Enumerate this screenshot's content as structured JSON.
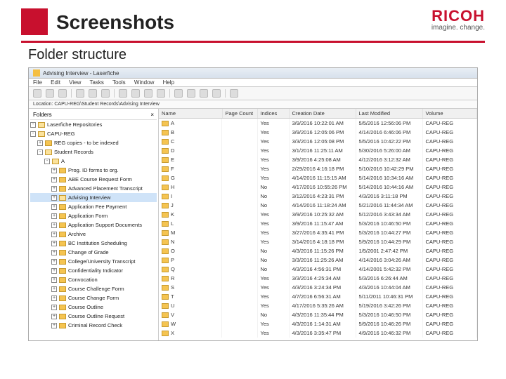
{
  "slide": {
    "title": "Screenshots",
    "subtitle": "Folder structure"
  },
  "logo": {
    "brand": "RICOH",
    "tagline": "imagine. change."
  },
  "window": {
    "title": "Advising Interview - Laserfiche"
  },
  "menu": {
    "file": "File",
    "edit": "Edit",
    "view": "View",
    "tasks": "Tasks",
    "tools": "Tools",
    "window": "Window",
    "help": "Help"
  },
  "breadcrumb": "Location:  CAPU-REG\\Student Records\\Advising Interview",
  "tree": {
    "header": "Folders",
    "close": "×",
    "root": "Laserfiche Repositories",
    "repo": "CAPU-REG",
    "items": [
      "REG copies - to be indexed",
      "Student Records",
      "A",
      "Prog. ID forms to org.",
      "ABE Course Request Form",
      "Advanced Placement Transcript",
      "Advising Interview",
      "Application Fee Payment",
      "Application Form",
      "Application Support Documents",
      "Archive",
      "BC Institution Scheduling",
      "Change of Grade",
      "College/University Transcript",
      "Confidentiality Indicator",
      "Convocation",
      "Course Challenge Form",
      "Course Change Form",
      "Course Outline",
      "Course Outline Request",
      "Criminal Record Check"
    ]
  },
  "columns": {
    "name": "Name",
    "pagecount": "Page Count",
    "indices": "Indices",
    "creation": "Creation Date",
    "modified": "Last Modified",
    "volume": "Volume"
  },
  "rows": [
    {
      "name": "A",
      "pc": "",
      "idx": "Yes",
      "cd": "3/9/2016 10:22:01 AM",
      "lm": "5/5/2016 12:56:06 PM",
      "vol": "CAPU-REG"
    },
    {
      "name": "B",
      "pc": "",
      "idx": "Yes",
      "cd": "3/9/2016 12:05:06 PM",
      "lm": "4/14/2016 6:46:06 PM",
      "vol": "CAPU-REG"
    },
    {
      "name": "C",
      "pc": "",
      "idx": "Yes",
      "cd": "3/3/2016 12:05:08 PM",
      "lm": "5/5/2016 10:42:22 PM",
      "vol": "CAPU-REG"
    },
    {
      "name": "D",
      "pc": "",
      "idx": "Yes",
      "cd": "3/1/2016 11:25:11 AM",
      "lm": "5/30/2016 5:26:00 AM",
      "vol": "CAPU-REG"
    },
    {
      "name": "E",
      "pc": "",
      "idx": "Yes",
      "cd": "3/9/2016 4:25:08 AM",
      "lm": "4/12/2016 3:12:32 AM",
      "vol": "CAPU-REG"
    },
    {
      "name": "F",
      "pc": "",
      "idx": "Yes",
      "cd": "2/29/2016 4:16:18 PM",
      "lm": "5/10/2016 10:42:29 PM",
      "vol": "CAPU-REG"
    },
    {
      "name": "G",
      "pc": "",
      "idx": "Yes",
      "cd": "4/14/2016 11:15:15 AM",
      "lm": "5/14/2016 10:34:16 AM",
      "vol": "CAPU-REG"
    },
    {
      "name": "H",
      "pc": "",
      "idx": "No",
      "cd": "4/17/2016 10:55:26 PM",
      "lm": "5/14/2016 10:44:16 AM",
      "vol": "CAPU-REG"
    },
    {
      "name": "I",
      "pc": "",
      "idx": "No",
      "cd": "3/12/2016 4:23:31 PM",
      "lm": "4/3/2016 3:11:18 PM",
      "vol": "CAPU-REG"
    },
    {
      "name": "J",
      "pc": "",
      "idx": "No",
      "cd": "4/14/2016 11:18:24 AM",
      "lm": "5/21/2016 11:44:34 AM",
      "vol": "CAPU-REG"
    },
    {
      "name": "K",
      "pc": "",
      "idx": "Yes",
      "cd": "3/9/2016 10:25:32 AM",
      "lm": "5/12/2016 3:43:34 AM",
      "vol": "CAPU-REG"
    },
    {
      "name": "L",
      "pc": "",
      "idx": "Yes",
      "cd": "3/9/2016 11:15:47 AM",
      "lm": "5/3/2016 10:46:50 PM",
      "vol": "CAPU-REG"
    },
    {
      "name": "M",
      "pc": "",
      "idx": "Yes",
      "cd": "3/27/2016 4:35:41 PM",
      "lm": "5/3/2016 10:44:27 PM",
      "vol": "CAPU-REG"
    },
    {
      "name": "N",
      "pc": "",
      "idx": "Yes",
      "cd": "3/14/2016 4:18:18 PM",
      "lm": "5/9/2016 10:44:29 PM",
      "vol": "CAPU-REG"
    },
    {
      "name": "O",
      "pc": "",
      "idx": "No",
      "cd": "4/3/2016 11:15:26 PM",
      "lm": "1/5/2001 2:47:42 PM",
      "vol": "CAPU-REG"
    },
    {
      "name": "P",
      "pc": "",
      "idx": "No",
      "cd": "3/3/2016 11:25:26 AM",
      "lm": "4/14/2016 3:04:26 AM",
      "vol": "CAPU-REG"
    },
    {
      "name": "Q",
      "pc": "",
      "idx": "No",
      "cd": "4/3/2016 4:56:31 PM",
      "lm": "4/14/2001 5:42:32 PM",
      "vol": "CAPU-REG"
    },
    {
      "name": "R",
      "pc": "",
      "idx": "Yes",
      "cd": "3/3/2016 4:25:34 AM",
      "lm": "5/3/2016 6:26:44 AM",
      "vol": "CAPU-REG"
    },
    {
      "name": "S",
      "pc": "",
      "idx": "Yes",
      "cd": "4/3/2016 3:24:34 PM",
      "lm": "4/3/2016 10:44:04 AM",
      "vol": "CAPU-REG"
    },
    {
      "name": "T",
      "pc": "",
      "idx": "Yes",
      "cd": "4/7/2016 6:56:31 AM",
      "lm": "5/11/2011 10:46:31 PM",
      "vol": "CAPU-REG"
    },
    {
      "name": "U",
      "pc": "",
      "idx": "Yes",
      "cd": "4/17/2016 5:35:26 AM",
      "lm": "5/19/2016 3:42:26 PM",
      "vol": "CAPU-REG"
    },
    {
      "name": "V",
      "pc": "",
      "idx": "No",
      "cd": "4/3/2016 11:35:44 PM",
      "lm": "5/3/2016 10:46:50 PM",
      "vol": "CAPU-REG"
    },
    {
      "name": "W",
      "pc": "",
      "idx": "Yes",
      "cd": "4/3/2016 1:14:31 AM",
      "lm": "5/9/2016 10:46:26 PM",
      "vol": "CAPU-REG"
    },
    {
      "name": "X",
      "pc": "",
      "idx": "Yes",
      "cd": "4/3/2016 3:35:47 PM",
      "lm": "4/9/2016 10:46:32 PM",
      "vol": "CAPU-REG"
    }
  ]
}
